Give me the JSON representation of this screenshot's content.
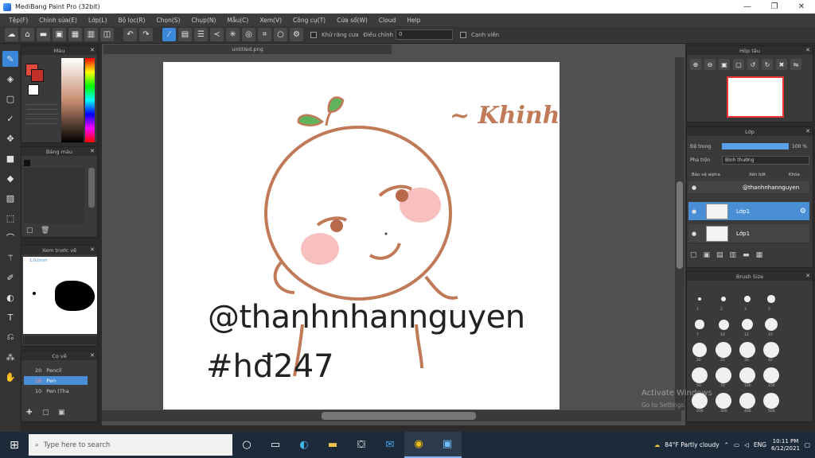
{
  "window": {
    "title": "MediBang Paint Pro (32bit)",
    "minimize": "—",
    "maximize": "❐",
    "close": "✕"
  },
  "menu": [
    "Tệp(F)",
    "Chỉnh sửa(E)",
    "Lớp(L)",
    "Bộ lọc(R)",
    "Chọn(S)",
    "Chụp(N)",
    "Mẫu(C)",
    "Xem(V)",
    "Công cụ(T)",
    "Cửa sổ(W)",
    "Cloud",
    "Help"
  ],
  "toolbar": {
    "snap_label": "Khử răng cưa",
    "adjust_label": "Điều chỉnh",
    "adjust_value": "0",
    "edge_label": "Cạnh viền"
  },
  "panels": {
    "color": {
      "title": "Màu"
    },
    "palette": {
      "title": "Bảng màu"
    },
    "navigator": {
      "title": "Xem trước vẽ",
      "zoom": "1.0,0mm"
    },
    "brush_list": {
      "title": "Cọ vẽ",
      "items": [
        {
          "size": "20",
          "name": "Pencil"
        },
        {
          "size": "16",
          "name": "Pen"
        },
        {
          "size": "10",
          "name": "Pen (Tha"
        }
      ]
    },
    "preview": {
      "title": "Hộp tấu"
    },
    "layer": {
      "title": "Lớp",
      "opacity_label": "Độ trong",
      "opacity_value": "100 %",
      "blend_label": "Pha trộn",
      "blend_value": "Bình thường",
      "protect_alpha": "Bảo vệ alpha",
      "clipping": "Xén bớt",
      "lock": "Khóa",
      "layers": [
        {
          "name": "@thanhnhannguyen"
        },
        {
          "name": "Lớp1"
        },
        {
          "name": "Lớp1"
        }
      ]
    },
    "brush_size": {
      "title": "Brush Size",
      "labels": [
        "1",
        "2",
        "3",
        "5",
        "7",
        "10",
        "12",
        "15",
        "20",
        "25",
        "30",
        "40",
        "50",
        "70",
        "100",
        "150",
        "200",
        "300",
        "400",
        "500"
      ]
    }
  },
  "document": {
    "tab": "untitled.png"
  },
  "artwork": {
    "signature": "~ Khinh",
    "handle": "@thanhnhannguyen",
    "tag": "#hđ247"
  },
  "watermark": {
    "line1": "Activate Windows",
    "line2": "Go to Settings"
  },
  "taskbar": {
    "search_placeholder": "Type here to search",
    "weather": "84°F  Partly cloudy",
    "lang": "ENG",
    "time": "10:11 PM",
    "date": "6/12/2021"
  },
  "colors": {
    "accent": "#3b87d9",
    "line": "#c17a58",
    "leaf": "#5fb35a",
    "blush": "#f28b8b"
  }
}
